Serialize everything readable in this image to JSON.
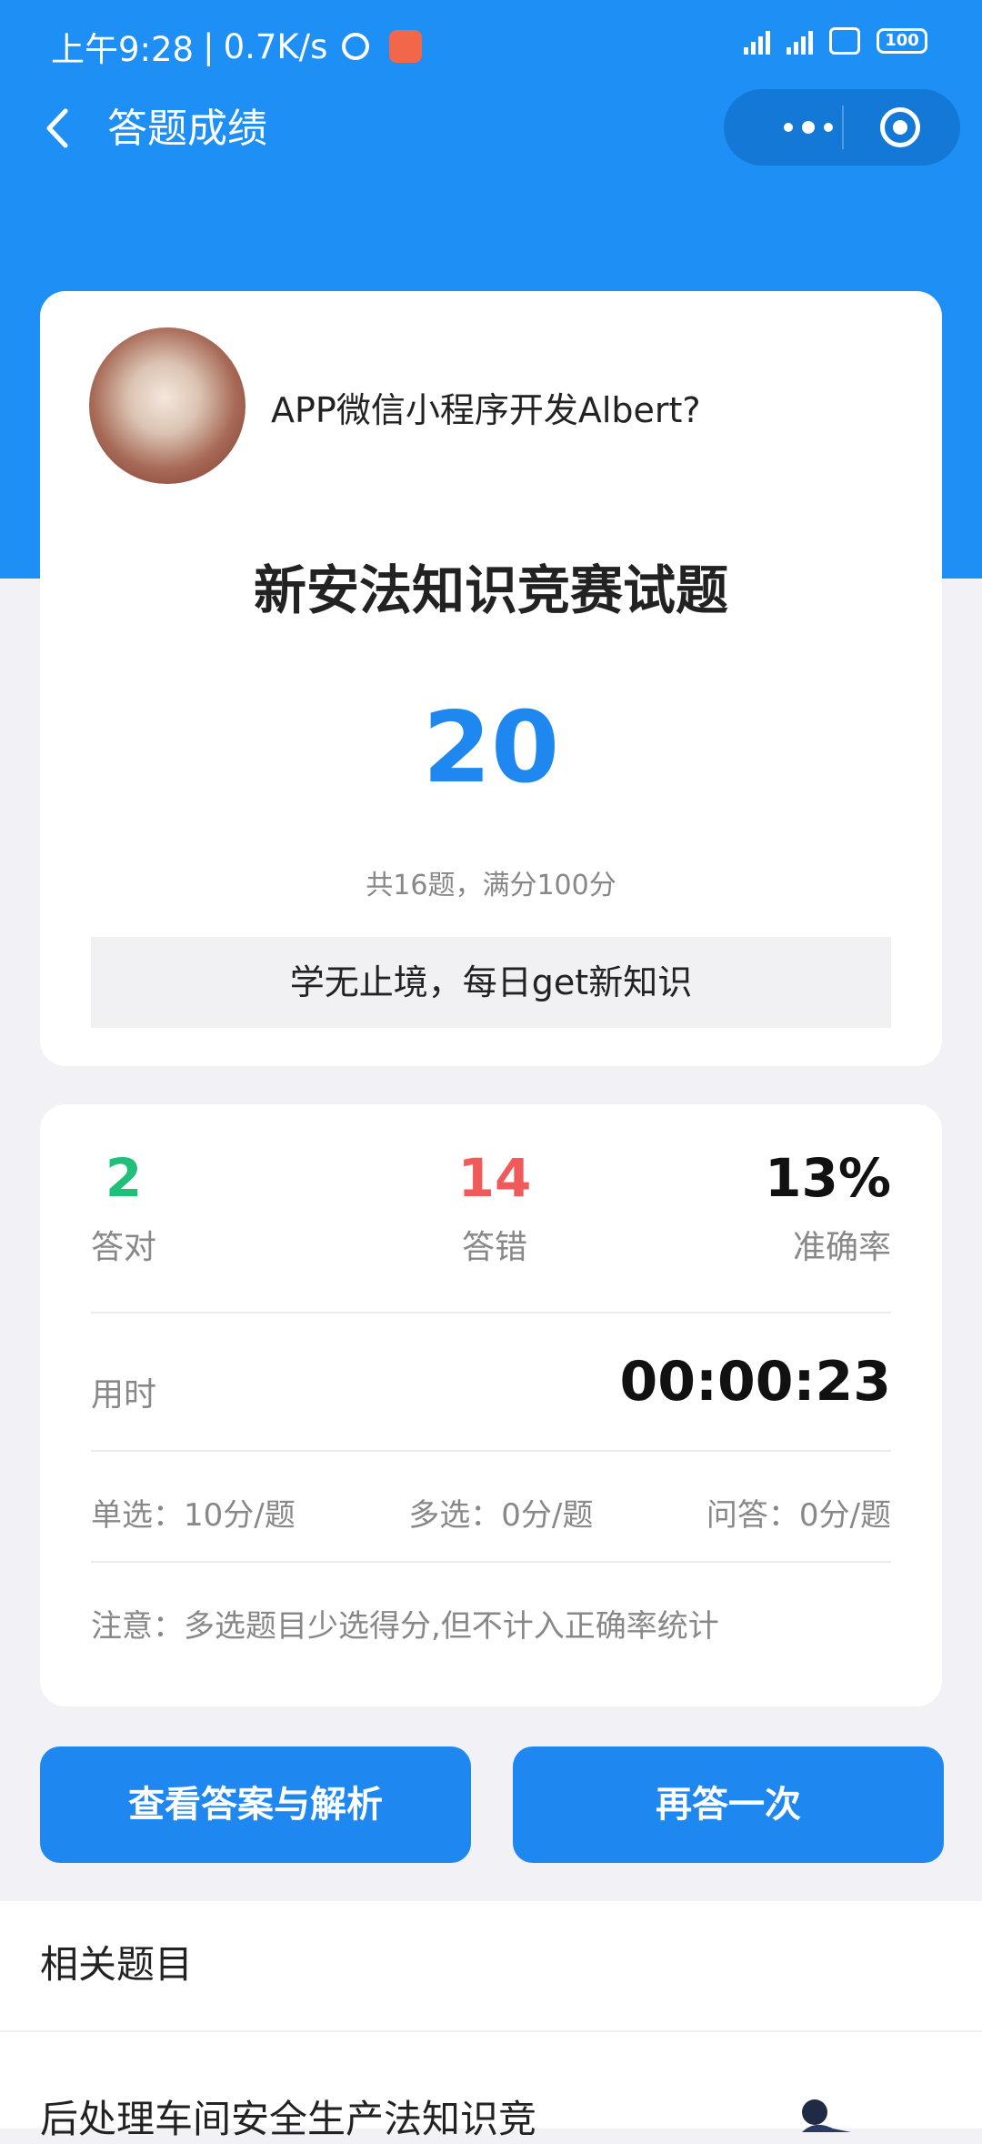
{
  "status_bar": {
    "time": "上午9:28",
    "speed": "0.7K/s",
    "battery": "100"
  },
  "nav": {
    "title": "答题成绩"
  },
  "profile": {
    "username": "APP微信小程序开发Albert?"
  },
  "quiz": {
    "title": "新安法知识竞赛试题",
    "score": "20",
    "summary": "共16题，满分100分",
    "motto": "学无止境，每日get新知识"
  },
  "stats": {
    "correct": {
      "value": "2",
      "label": "答对"
    },
    "wrong": {
      "value": "14",
      "label": "答错"
    },
    "accuracy": {
      "value": "13%",
      "label": "准确率"
    },
    "time_label": "用时",
    "time_value": "00:00:23",
    "rules": {
      "single": "单选：10分/题",
      "multiple": "多选：0分/题",
      "qa": "问答：0分/题"
    },
    "note": "注意：多选题目少选得分,但不计入正确率统计"
  },
  "buttons": {
    "view_answers": "查看答案与解析",
    "retry": "再答一次"
  },
  "related": {
    "title": "相关题目",
    "items": [
      {
        "title": "后处理车间安全生产法知识竞"
      }
    ]
  },
  "colors": {
    "primary": "#1e90f5",
    "correct": "#20c07a",
    "wrong": "#f05a5a"
  }
}
